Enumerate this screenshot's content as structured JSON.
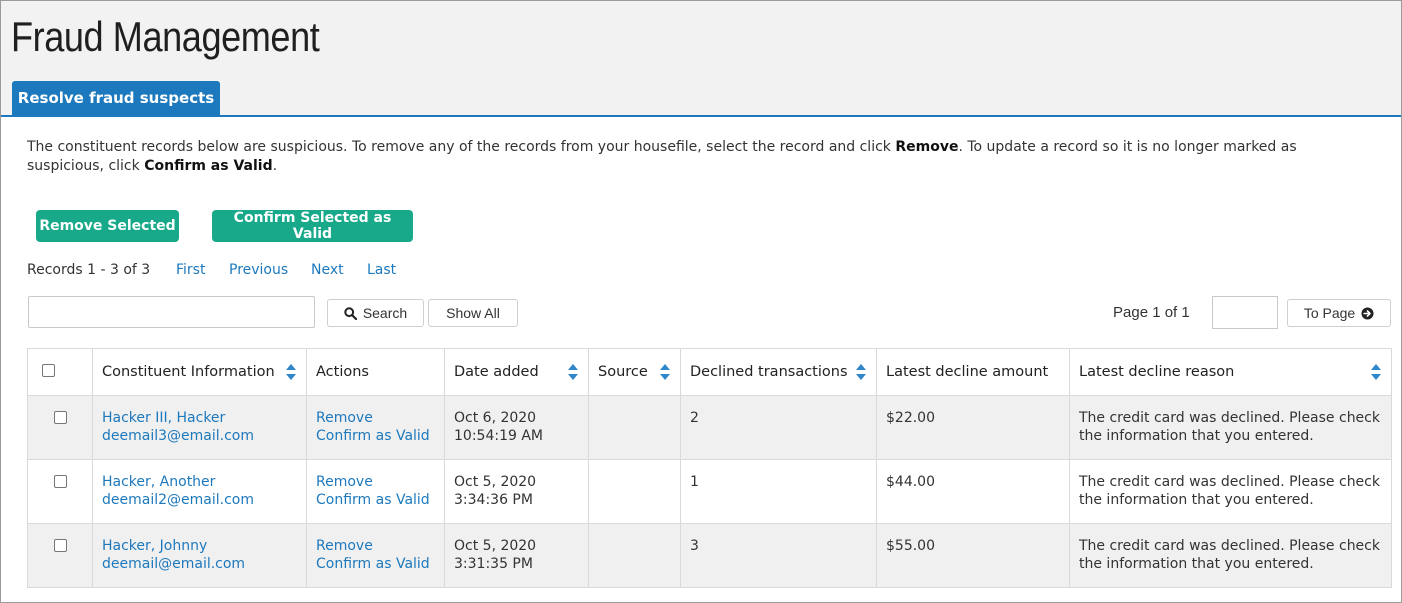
{
  "page": {
    "title": "Fraud Management"
  },
  "tab": {
    "label": "Resolve fraud suspects"
  },
  "intro": {
    "part1": "The constituent records below are suspicious. To remove any of the records from your housefile, select the record and click ",
    "bold1": "Remove",
    "part2": ". To update a record so it is no longer marked as suspicious, click ",
    "bold2": "Confirm as Valid",
    "part3": "."
  },
  "actions": {
    "remove_selected": "Remove Selected",
    "confirm_selected": "Confirm Selected as Valid"
  },
  "pager": {
    "records": "Records 1 - 3 of 3",
    "first": "First",
    "previous": "Previous",
    "next": "Next",
    "last": "Last"
  },
  "search": {
    "value": "",
    "search_label": "Search",
    "show_all_label": "Show All",
    "page_label": "Page 1 of 1",
    "page_value": "",
    "to_page_label": "To Page"
  },
  "table": {
    "headers": {
      "constituent": "Constituent Information",
      "actions": "Actions",
      "date": "Date added",
      "source": "Source",
      "declined": "Declined transactions",
      "amount": "Latest decline amount",
      "reason": "Latest decline reason"
    },
    "rows": [
      {
        "name": "Hacker III, Hacker",
        "email": "deemail3@email.com",
        "remove": "Remove",
        "confirm": "Confirm as Valid",
        "date": "Oct 6, 2020",
        "time": "10:54:19 AM",
        "source": "",
        "declined": "2",
        "amount": "$22.00",
        "reason": "The credit card was declined. Please check the information that you entered."
      },
      {
        "name": "Hacker, Another",
        "email": "deemail2@email.com",
        "remove": "Remove",
        "confirm": "Confirm as Valid",
        "date": "Oct 5, 2020",
        "time": "3:34:36 PM",
        "source": "",
        "declined": "1",
        "amount": "$44.00",
        "reason": "The credit card was declined. Please check the information that you entered."
      },
      {
        "name": "Hacker, Johnny",
        "email": "deemail@email.com",
        "remove": "Remove",
        "confirm": "Confirm as Valid",
        "date": "Oct 5, 2020",
        "time": "3:31:35 PM",
        "source": "",
        "declined": "3",
        "amount": "$55.00",
        "reason": "The credit card was declined. Please check the information that you entered."
      }
    ]
  },
  "colors": {
    "accent": "#1d79bd",
    "button_green": "#17a98a",
    "row_alt": "#f0f0f0"
  },
  "icons": {
    "search": "search-icon",
    "to_page": "arrow-circle-right-icon",
    "sort": "sort-icon"
  }
}
